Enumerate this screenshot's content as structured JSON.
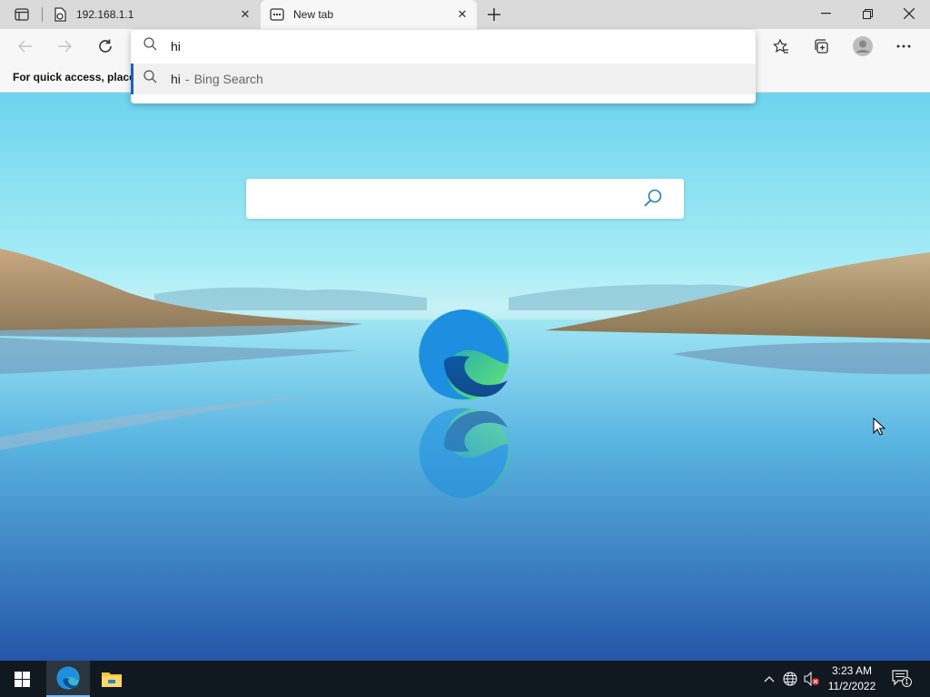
{
  "tabs": [
    {
      "title": "192.168.1.1",
      "icon": "file-page-icon",
      "active": false
    },
    {
      "title": "New tab",
      "icon": "new-tab-page-icon",
      "active": true
    }
  ],
  "toolbar": {
    "back_icon": "back-arrow-icon",
    "forward_icon": "forward-arrow-icon",
    "refresh_icon": "refresh-icon"
  },
  "favorites_bar": {
    "text": "For quick access, place y"
  },
  "omnibox": {
    "value": "hi",
    "suggestion": {
      "query": "hi",
      "separator": "-",
      "engine": "Bing Search"
    }
  },
  "taskbar": {
    "time": "3:23 AM",
    "date": "11/2/2022",
    "notification_count": "1"
  },
  "colors": {
    "accent": "#1a63b8",
    "taskbar": "#101820",
    "tabstrip": "#dadada"
  }
}
